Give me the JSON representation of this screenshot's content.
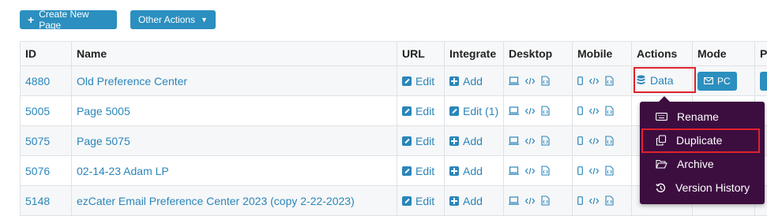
{
  "toolbar": {
    "create_label": "Create New Page",
    "other_actions_label": "Other Actions"
  },
  "table": {
    "headers": {
      "id": "ID",
      "name": "Name",
      "url": "URL",
      "integrate": "Integrate",
      "desktop": "Desktop",
      "mobile": "Mobile",
      "actions": "Actions",
      "mode": "Mode",
      "p": "Pr"
    },
    "rows": [
      {
        "id": "4880",
        "name": "Old Preference Center",
        "url": "Edit",
        "integrate": "Add",
        "action": "Data",
        "mode": "PC"
      },
      {
        "id": "5005",
        "name": "Page 5005",
        "url": "Edit",
        "integrate": "Edit (1)"
      },
      {
        "id": "5075",
        "name": "Page 5075",
        "url": "Edit",
        "integrate": "Add"
      },
      {
        "id": "5076",
        "name": "02-14-23 Adam LP",
        "url": "Edit",
        "integrate": "Add"
      },
      {
        "id": "5148",
        "name": "ezCater Email Preference Center 2023 (copy 2-22-2023)",
        "url": "Edit",
        "integrate": "Add"
      }
    ]
  },
  "menu": {
    "items": [
      "Rename",
      "Duplicate",
      "Archive",
      "Version History"
    ]
  },
  "colors": {
    "primary": "#2b8fbf",
    "link": "#2a86bb",
    "menu_bg": "#3c0e40",
    "highlight": "#e0222c"
  }
}
